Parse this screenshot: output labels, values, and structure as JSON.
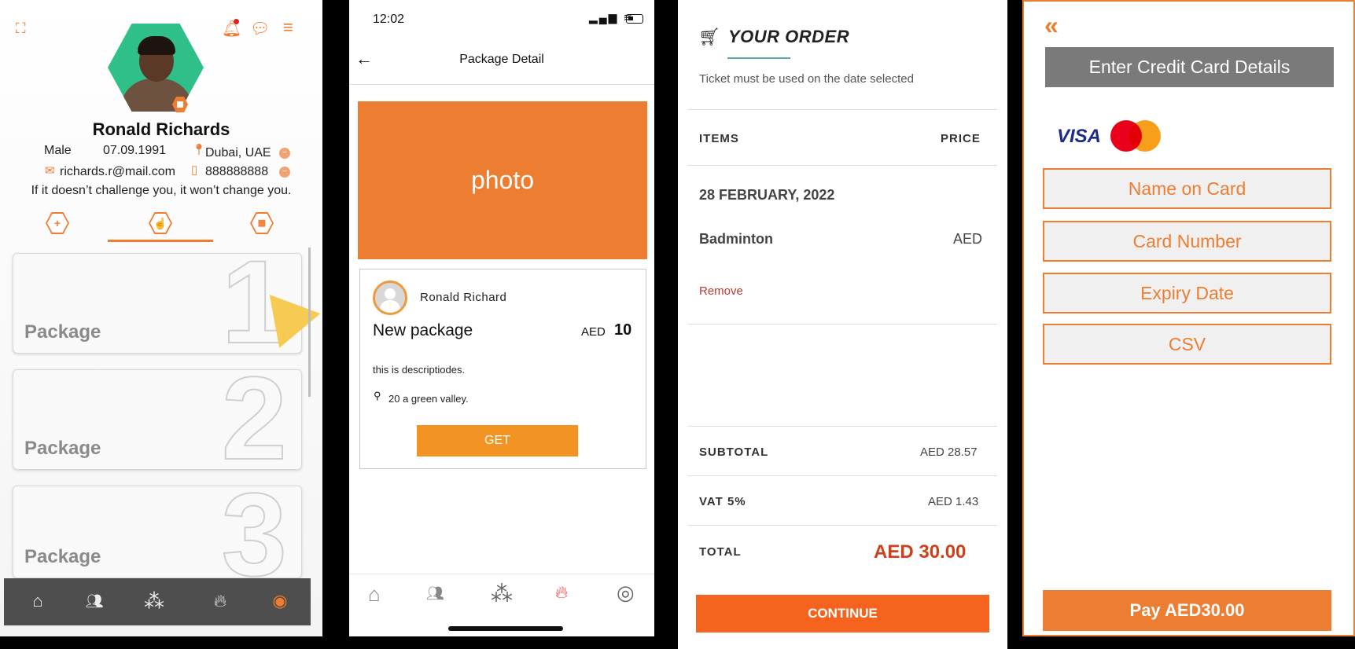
{
  "profile": {
    "name": "Ronald Richards",
    "gender": "Male",
    "dob": "07.09.1991",
    "location": "Dubai, UAE",
    "email": "richards.r@mail.com",
    "phone": "888888888",
    "bio": "If it doesn’t challenge you, it won’t change you.",
    "packages": [
      {
        "label": "Package",
        "number": "1"
      },
      {
        "label": "Package",
        "number": "2"
      },
      {
        "label": "Package",
        "number": "3"
      }
    ]
  },
  "package_detail": {
    "status_time": "12:02",
    "title": "Package Detail",
    "photo_label": "photo",
    "owner_name": "Ronald Richard",
    "package_name": "New package",
    "currency": "AED",
    "price": "10",
    "description": "this is descriptiodes.",
    "address": "20 a green valley.",
    "get_label": "GET"
  },
  "order": {
    "title": "YOUR ORDER",
    "note": "Ticket must be used on the date selected",
    "items_header": "ITEMS",
    "price_header": "PRICE",
    "date": "28 FEBRUARY, 2022",
    "item_name": "Badminton",
    "item_price": "AED",
    "remove_label": "Remove",
    "subtotal_label": "SUBTOTAL",
    "subtotal_value": "AED 28.57",
    "vat_label": "VAT 5%",
    "vat_value": "AED 1.43",
    "total_label": "TOTAL",
    "total_value": "AED 30.00",
    "continue_label": "CONTINUE"
  },
  "payment": {
    "back_icon": "«",
    "title": "Enter Credit Card Details",
    "visa_label": "VISA",
    "fields": [
      "Name on Card",
      "Card Number",
      "Expiry Date",
      "CSV"
    ],
    "pay_label": "Pay AED30.00"
  },
  "colors": {
    "orange": "#ed7d31",
    "continue_orange": "#f5631e",
    "total_red": "#d0401a"
  }
}
